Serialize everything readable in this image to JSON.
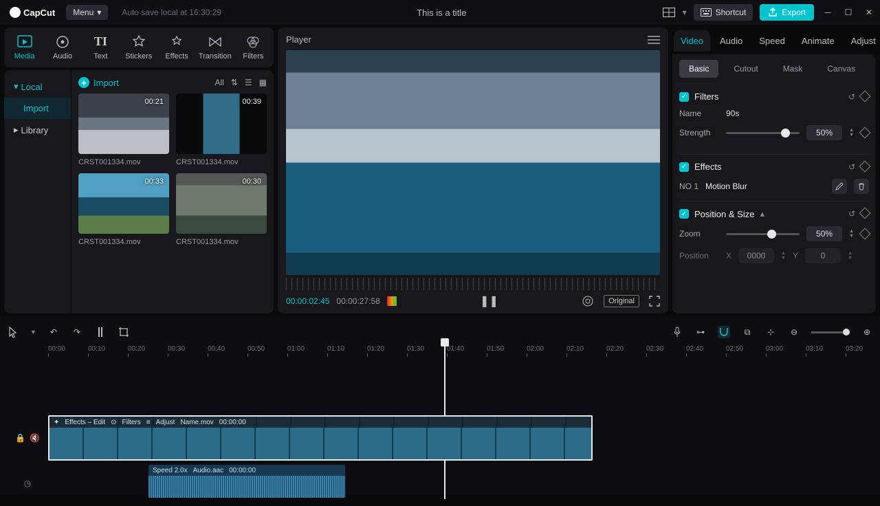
{
  "app": {
    "name": "CapCut",
    "menu": "Menu",
    "autosave": "Auto save local at 16:30:29",
    "title": "This is a title",
    "shortcut": "Shortcut",
    "export": "Export"
  },
  "top_tabs": [
    "Media",
    "Audio",
    "Text",
    "Stickers",
    "Effects",
    "Transition",
    "Filters"
  ],
  "top_tabs_active": "Media",
  "sidebar": {
    "items": [
      "Local",
      "Import",
      "Library"
    ],
    "active": "Local",
    "selected": "Import"
  },
  "media": {
    "import_label": "Import",
    "filter": "All",
    "clips": [
      {
        "name": "CRST001334.mov",
        "duration": "00:21",
        "thumb": "th1"
      },
      {
        "name": "CRST001334.mov",
        "duration": "00:39",
        "thumb": "th2"
      },
      {
        "name": "CRST001334.mov",
        "duration": "00:33",
        "thumb": "th3"
      },
      {
        "name": "CRST001334.mov",
        "duration": "00:30",
        "thumb": "th4"
      }
    ]
  },
  "player": {
    "title": "Player",
    "current": "00:00:02:45",
    "total": "00:00:27:58",
    "original": "Original"
  },
  "inspector": {
    "tabs": [
      "Video",
      "Audio",
      "Speed",
      "Animate",
      "Adjust"
    ],
    "tabs_active": "Video",
    "subtabs": [
      "Basic",
      "Cutout",
      "Mask",
      "Canvas"
    ],
    "subtabs_active": "Basic",
    "filters": {
      "title": "Filters",
      "name_label": "Name",
      "name_value": "90s",
      "strength_label": "Strength",
      "strength_value": "50%",
      "strength_pct": 75
    },
    "effects": {
      "title": "Effects",
      "idx": "NO 1",
      "name": "Motion Blur"
    },
    "pos": {
      "title": "Position & Size",
      "zoom_label": "Zoom",
      "zoom_value": "50%",
      "zoom_pct": 56,
      "pos_label": "Position",
      "x_label": "X",
      "x_value": "0000",
      "y_label": "Y",
      "y_value": "0"
    }
  },
  "timeline": {
    "ticks": [
      "00:00",
      "00:10",
      "00:20",
      "00:30",
      "00:40",
      "00:50",
      "01:00",
      "01:10",
      "01:20",
      "01:30",
      "01:40",
      "01:50",
      "02:00",
      "02:10",
      "02:20",
      "02:30",
      "02:40",
      "02:50",
      "03:00",
      "03:10",
      "03:20"
    ],
    "vclip": {
      "effects": "Effects – Edit",
      "filters": "Filters",
      "adjust": "Adjust",
      "name": "Name.mov",
      "tc": "00:00:00"
    },
    "aclip": {
      "speed": "Speed 2.0x",
      "name": "Audio.aac",
      "tc": "00:00:00"
    }
  }
}
